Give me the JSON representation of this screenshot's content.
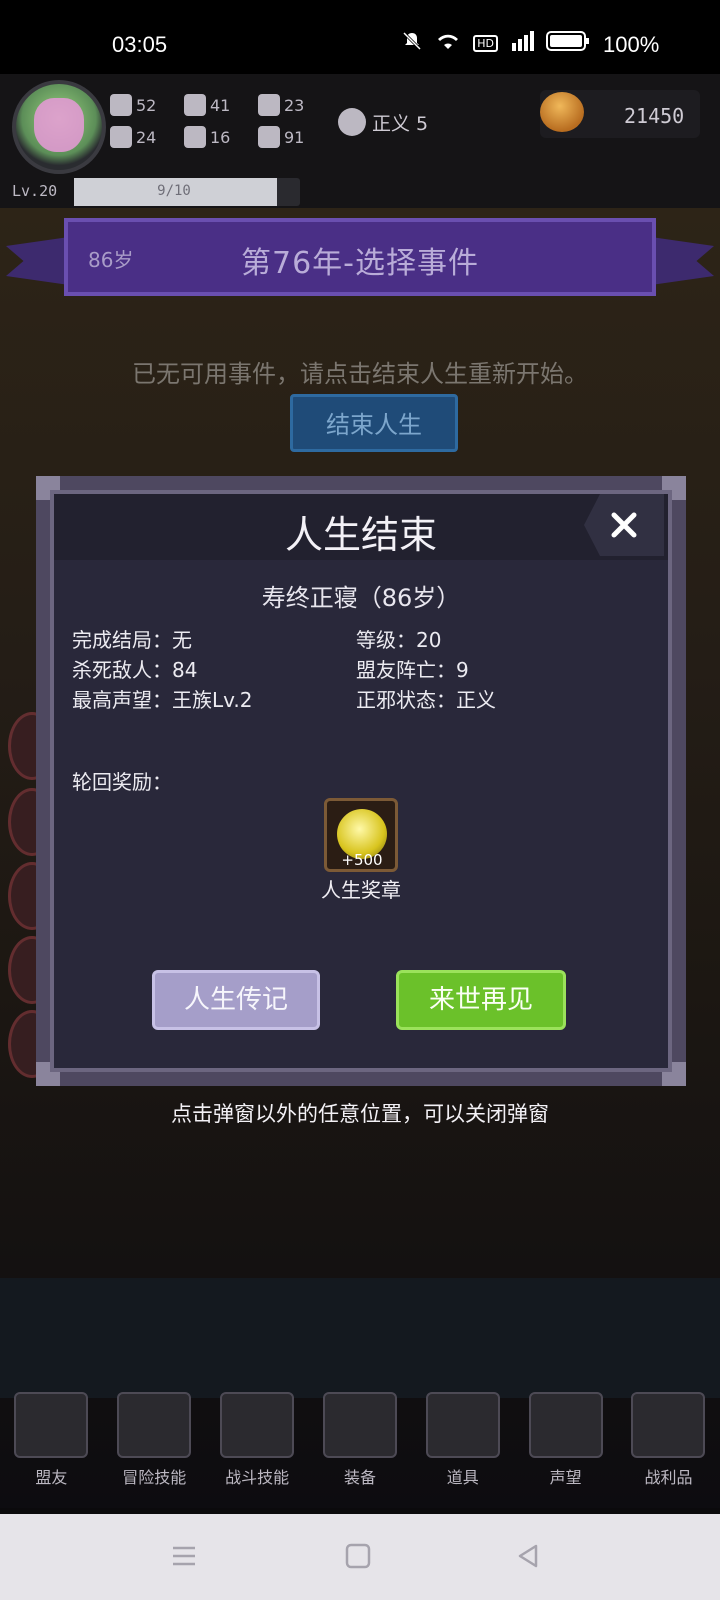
{
  "status_bar": {
    "time": "03:05",
    "battery": "100%"
  },
  "hud": {
    "stats": [
      {
        "icon": "fist-icon",
        "value": "52"
      },
      {
        "icon": "boot-icon",
        "value": "41"
      },
      {
        "icon": "wizard-hat-icon",
        "value": "23"
      },
      {
        "icon": "clover-icon",
        "value": "24"
      },
      {
        "icon": "armor-icon",
        "value": "16"
      },
      {
        "icon": "lotus-icon",
        "value": "91"
      }
    ],
    "alignment": "正义 5",
    "gold": "21450",
    "level": "Lv.20",
    "xp_text": "9/10",
    "xp_fraction": 0.9
  },
  "banner": {
    "age": "86岁",
    "title": "第76年-选择事件"
  },
  "scene": {
    "no_events": "已无可用事件，请点击结束人生重新开始。",
    "end_life_button": "结束人生"
  },
  "modal": {
    "title": "人生结束",
    "cause": "寿终正寝（86岁）",
    "fields": {
      "ending": "完成结局：无",
      "level": "等级：20",
      "kills": "杀死敌人：84",
      "ally_deaths": "盟友阵亡：9",
      "reputation": "最高声望：王族Lv.2",
      "alignment": "正邪状态：正义"
    },
    "reward_label": "轮回奖励：",
    "reward_amount": "+500",
    "reward_name": "人生奖章",
    "bio_button": "人生传记",
    "next_button": "来世再见"
  },
  "hint": "点击弹窗以外的任意位置，可以关闭弹窗",
  "nav": [
    "盟友",
    "冒险技能",
    "战斗技能",
    "装备",
    "道具",
    "声望",
    "战利品"
  ]
}
